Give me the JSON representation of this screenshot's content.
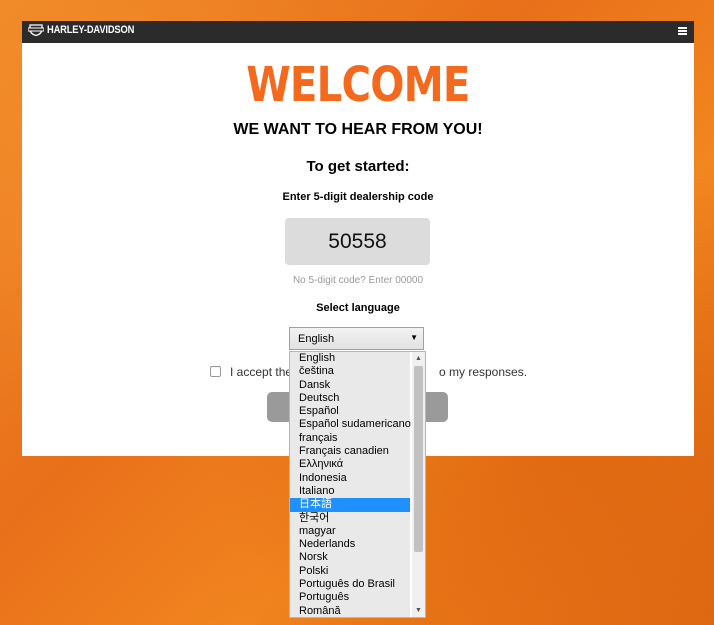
{
  "header": {
    "brand": "HARLEY-DAVIDSON",
    "logo_icon": "bar-shield-icon",
    "menu_icon": "hamburger-menu-icon"
  },
  "main": {
    "welcome": "WELCOME",
    "subtitle": "WE WANT TO HEAR FROM YOU!",
    "get_started": "To get started:",
    "code_label": "Enter 5-digit dealership code",
    "code_value": "50558",
    "code_hint": "No 5-digit code? Enter 00000",
    "language_label": "Select language",
    "accept_text_visible": "I accept the",
    "accept_text_tail": "o my responses."
  },
  "language_select": {
    "selected": "English",
    "highlighted": "日本語",
    "options": [
      "English",
      "čeština",
      "Dansk",
      "Deutsch",
      "Español",
      "Español sudamericano",
      "français",
      "Français canadien",
      "Ελληνικά",
      "Indonesia",
      "Italiano",
      "日本語",
      "한국어",
      "magyar",
      "Nederlands",
      "Norsk",
      "Polski",
      "Português do Brasil",
      "Português",
      "Română"
    ]
  },
  "colors": {
    "accent": "#f36a1f",
    "header_bg": "#2b2b2b",
    "highlight": "#1e90ff",
    "background": "#ec7a1e"
  }
}
